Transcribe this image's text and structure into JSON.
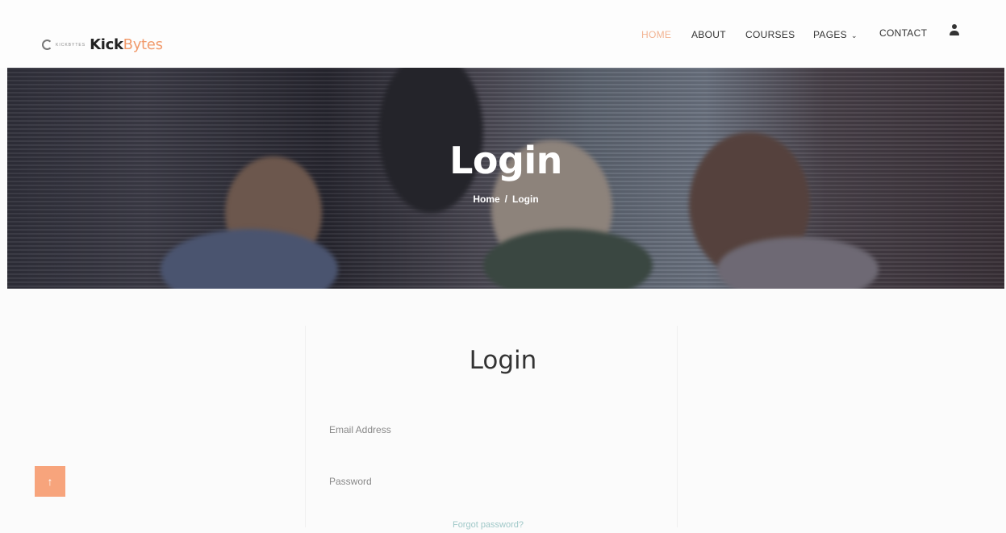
{
  "brand": {
    "tagline": "KICKBYTES",
    "name_main": "Kick",
    "name_accent": "Bytes"
  },
  "nav": {
    "items": [
      "HOME",
      "ABOUT",
      "COURSES",
      "PAGES",
      "CONTACT"
    ],
    "active": "HOME",
    "pages_chevron": "⌄",
    "user_icon": "user-icon"
  },
  "hero": {
    "title": "Login",
    "breadcrumb": {
      "home": "Home",
      "separator": "/",
      "current": "Login"
    }
  },
  "login": {
    "title": "Login",
    "email_placeholder": "Email Address",
    "password_placeholder": "Password",
    "forgot_password": "Forgot password?"
  },
  "back_to_top": {
    "icon": "arrow-up-icon",
    "glyph": "↑"
  },
  "colors": {
    "accent": "#f19a6b",
    "active_nav": "#f2b493",
    "back_to_top": "#f7a47c",
    "link": "#9fc8c8"
  }
}
